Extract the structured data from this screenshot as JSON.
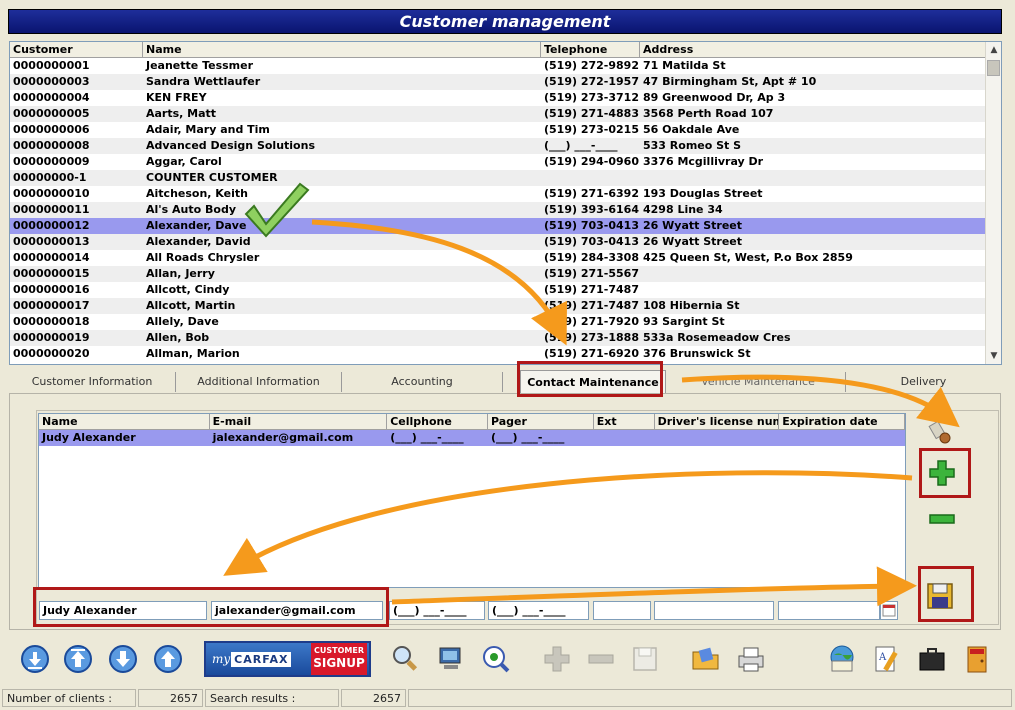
{
  "title": "Customer management",
  "customers": {
    "columns": [
      "Customer",
      "Name",
      "Telephone",
      "Address"
    ],
    "rows": [
      [
        "0000000001",
        "Jeanette Tessmer",
        "(519) 272-9892",
        "71 Matilda St"
      ],
      [
        "0000000003",
        "Sandra Wettlaufer",
        "(519) 272-1957",
        "47 Birmingham St, Apt # 10"
      ],
      [
        "0000000004",
        " KEN FREY",
        "(519) 273-3712",
        "89 Greenwood Dr, Ap 3"
      ],
      [
        "0000000005",
        "Aarts, Matt",
        "(519) 271-4883",
        "3568 Perth Road 107"
      ],
      [
        "0000000006",
        "Adair, Mary and Tim",
        "(519) 273-0215",
        "56 Oakdale Ave"
      ],
      [
        "0000000008",
        "Advanced Design Solutions",
        "(___) ___-____",
        "533 Romeo St S"
      ],
      [
        "0000000009",
        "Aggar, Carol",
        "(519) 294-0960",
        "3376 Mcgillivray Dr"
      ],
      [
        "00000000-1",
        "COUNTER CUSTOMER",
        "",
        ""
      ],
      [
        "0000000010",
        "Aitcheson, Keith",
        "(519) 271-6392",
        "193 Douglas Street"
      ],
      [
        "0000000011",
        "Al's Auto Body",
        "(519) 393-6164",
        "4298 Line 34"
      ],
      [
        "0000000012",
        "Alexander, Dave",
        "(519) 703-0413",
        "26 Wyatt Street"
      ],
      [
        "0000000013",
        "Alexander, David",
        "(519) 703-0413",
        "26 Wyatt Street"
      ],
      [
        "0000000014",
        "All Roads Chrysler",
        "(519) 284-3308",
        "425 Queen St, West, P.o Box 2859"
      ],
      [
        "0000000015",
        "Allan, Jerry",
        "(519) 271-5567",
        ""
      ],
      [
        "0000000016",
        "Allcott, Cindy",
        "(519) 271-7487",
        ""
      ],
      [
        "0000000017",
        "Allcott, Martin",
        "(519) 271-7487",
        "108 Hibernia St"
      ],
      [
        "0000000018",
        "Allely, Dave",
        "(519) 271-7920",
        "93 Sargint St"
      ],
      [
        "0000000019",
        "Allen, Bob",
        "(519) 273-1888",
        "533a Rosemeadow Cres"
      ],
      [
        "0000000020",
        "Allman, Marion",
        "(519) 271-6920",
        "376 Brunswick St"
      ]
    ],
    "selected_index": 10
  },
  "tabs": [
    "Customer Information",
    "Additional Information",
    "Accounting",
    "Contact Maintenance",
    "Vehicle Maintenance",
    "Delivery"
  ],
  "active_tab": "Contact Maintenance",
  "contacts": {
    "columns": [
      "Name",
      "E-mail",
      "Cellphone",
      "Pager",
      "Ext",
      "Driver's license numb",
      "Expiration date"
    ],
    "rows": [
      [
        "Judy Alexander",
        "jalexander@gmail.com",
        "(___) ___-____",
        "(___) ___-____",
        "",
        "",
        ""
      ]
    ]
  },
  "edit": {
    "name": "Judy Alexander",
    "email": "jalexander@gmail.com",
    "cellphone": "(___) ___-____",
    "pager": "(___) ___-____",
    "ext": "",
    "license": "",
    "expiration": ""
  },
  "carfax": {
    "my": "my",
    "brand": "CARFAX",
    "badge_top": "CUSTOMER",
    "badge_bottom": "SIGNUP"
  },
  "status": {
    "clients_label": "Number of clients :",
    "clients_value": "2657",
    "results_label": "Search results :",
    "results_value": "2657"
  },
  "colors": {
    "title_bar": "#0a1470",
    "selection": "#9999ee",
    "annotation_red": "#b01818",
    "annotation_arrow": "#f59a1c",
    "checkmark": "#5aa02a"
  },
  "icons": [
    "nav-first-icon",
    "nav-prev-icon",
    "nav-next-icon",
    "nav-last-icon",
    "search-icon",
    "computer-icon",
    "eye-search-icon",
    "add-icon",
    "remove-icon",
    "save-icon",
    "folder-icon",
    "printer-icon",
    "globe-mail-icon",
    "edit-document-icon",
    "briefcase-icon",
    "exit-icon",
    "tool-icon",
    "floppy-icon"
  ]
}
